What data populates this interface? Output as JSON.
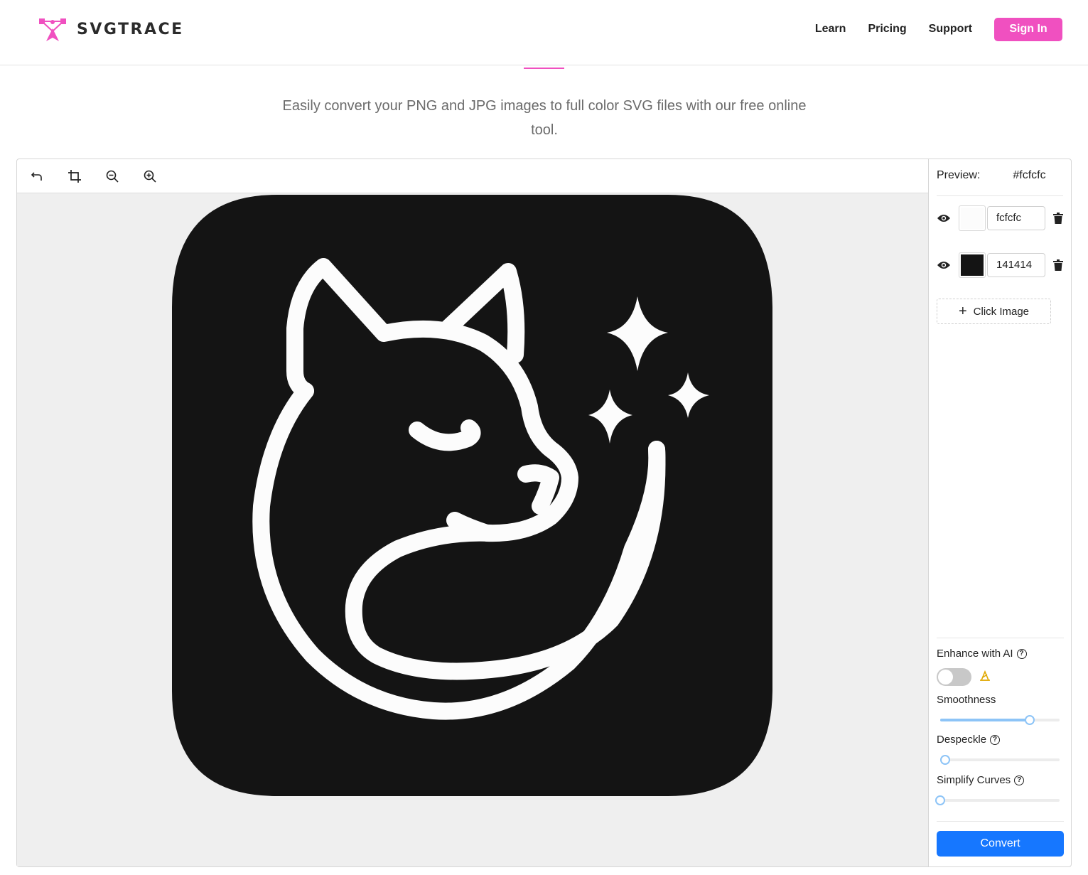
{
  "header": {
    "brand": "SVGTRACE",
    "nav": [
      "Learn",
      "Pricing",
      "Support"
    ],
    "sign_in": "Sign In"
  },
  "colors": {
    "accent": "#f050c0",
    "primary": "#1677ff",
    "canvas_bg": "#efefef"
  },
  "tagline": "Easily convert your PNG and JPG images to full color SVG files with our free online tool.",
  "toolbar": {
    "tools": [
      "undo-icon",
      "crop-icon",
      "zoom-out-icon",
      "zoom-in-icon"
    ]
  },
  "sidebar": {
    "preview_label": "Preview:",
    "preview_hex": "#fcfcfc",
    "palette": [
      {
        "hex": "fcfcfc",
        "swatch": "#fcfcfc",
        "visible": true
      },
      {
        "hex": "141414",
        "swatch": "#141414",
        "visible": true
      }
    ],
    "click_image": "Click Image",
    "enhance_label": "Enhance with AI",
    "enhance_on": false,
    "smoothness_label": "Smoothness",
    "smoothness_value": 0.75,
    "despeckle_label": "Despeckle",
    "despeckle_value": 0.04,
    "simplify_label": "Simplify Curves",
    "simplify_value": 0.0,
    "convert": "Convert"
  }
}
